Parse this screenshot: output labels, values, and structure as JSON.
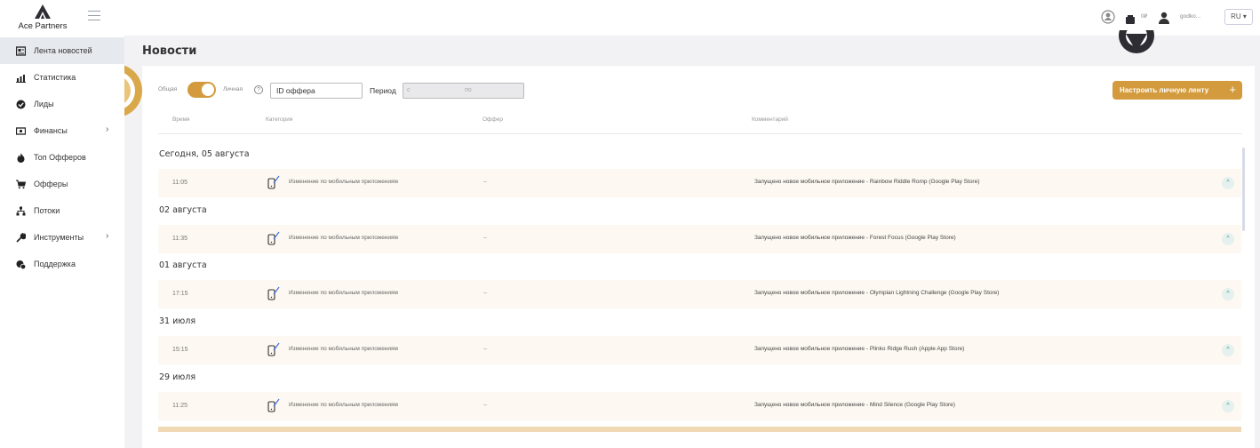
{
  "app": {
    "logo_text": "Ace Partners"
  },
  "header": {
    "balance": "0₽",
    "username": "godko...",
    "language": "RU ▾"
  },
  "sidebar": {
    "items": [
      {
        "label": "Лента новостей",
        "icon": "newspaper-icon",
        "active": true
      },
      {
        "label": "Статистика",
        "icon": "chart-icon"
      },
      {
        "label": "Лиды",
        "icon": "check-circle-icon"
      },
      {
        "label": "Финансы",
        "icon": "money-icon",
        "has_submenu": true
      },
      {
        "label": "Топ Офферов",
        "icon": "fire-icon"
      },
      {
        "label": "Офферы",
        "icon": "cart-icon"
      },
      {
        "label": "Потоки",
        "icon": "sitemap-icon"
      },
      {
        "label": "Инструменты",
        "icon": "wrench-icon",
        "has_submenu": true
      },
      {
        "label": "Поддержка",
        "icon": "support-icon"
      }
    ]
  },
  "main": {
    "title": "Новости",
    "filters": {
      "general_label": "Общая",
      "personal_label": "Личная",
      "offer_id_value": "ID оффера",
      "period_label": "Период",
      "period_from": "с",
      "period_to": "по",
      "configure_button": "Настроить личную ленту",
      "configure_plus": "+"
    },
    "columns": {
      "time": "Время",
      "category": "Категория",
      "offer": "Оффер",
      "comment": "Комментарий"
    },
    "groups": [
      {
        "date": "Сегодня, 05 августа",
        "rows": [
          {
            "time": "11:05",
            "category": "Изменение по мобильным приложениям",
            "offer": "–",
            "comment": "Запущено новое мобильное приложение - Rainbow Riddle Romp (Google Play Store)"
          }
        ]
      },
      {
        "date": "02 августа",
        "rows": [
          {
            "time": "11:35",
            "category": "Изменение по мобильным приложениям",
            "offer": "–",
            "comment": "Запущено новое мобильное приложение - Forest Focus (Google Play Store)"
          }
        ]
      },
      {
        "date": "01 августа",
        "rows": [
          {
            "time": "17:15",
            "category": "Изменение по мобильным приложениям",
            "offer": "–",
            "comment": "Запущено новое мобильное приложение - Olympian Lightning Challenge (Google Play Store)"
          }
        ]
      },
      {
        "date": "31 июля",
        "rows": [
          {
            "time": "15:15",
            "category": "Изменение по мобильным приложениям",
            "offer": "–",
            "comment": "Запущено новое мобильное приложение - Plinko Ridge Rush (Apple App Store)"
          }
        ]
      },
      {
        "date": "29 июля",
        "rows": [
          {
            "time": "11:25",
            "category": "Изменение по мобильным приложениям",
            "offer": "–",
            "comment": "Запущено новое мобильное приложение - Mind Silence (Google Play Store)"
          }
        ]
      }
    ],
    "expand_glyph": "^"
  },
  "colors": {
    "accent": "#d39b3d",
    "row_bg": "#fdf8f2",
    "active_sidebar": "#e6e9ee"
  }
}
